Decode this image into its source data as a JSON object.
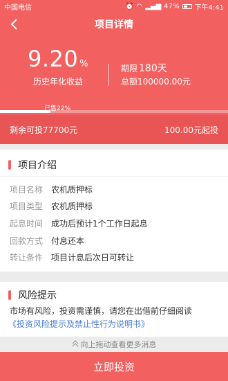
{
  "status": {
    "carrier": "中国电信",
    "battery": "47%",
    "time": "下午4:41"
  },
  "nav": {
    "title": "项目详情"
  },
  "summary": {
    "rate": "9.20",
    "rate_unit": "%",
    "rate_label": "历史年化收益",
    "term_label": "期限",
    "term_value": "180天",
    "total_label": "总额",
    "total_value": "100000.00元",
    "sold_text": "已售22%",
    "sold_fraction": 0.22
  },
  "sub_bar": {
    "remaining": "剩余可投77700元",
    "min_invest": "100.00元起投"
  },
  "intro": {
    "title": "项目介绍",
    "rows": [
      {
        "k": "项目名称",
        "v": "农机质押标"
      },
      {
        "k": "项目类型",
        "v": "农机质押标"
      },
      {
        "k": "起息时间",
        "v": "成功后预计1个工作日起息"
      },
      {
        "k": "回款方式",
        "v": "付息还本"
      },
      {
        "k": "转让条件",
        "v": "项目计息后次日可转让"
      }
    ]
  },
  "risk": {
    "title": "风险提示",
    "text": "市场有风险，投资需谨慎，请您在出借前仔细阅读",
    "link": "《投资风险提示及禁止性行为说明书》"
  },
  "more": {
    "text": "向上拖动查看更多消息"
  },
  "cta": {
    "label": "立即投资"
  },
  "colors": {
    "primary": "#f26060",
    "sub_bar": "#e95454",
    "link": "#4a7fd4"
  }
}
